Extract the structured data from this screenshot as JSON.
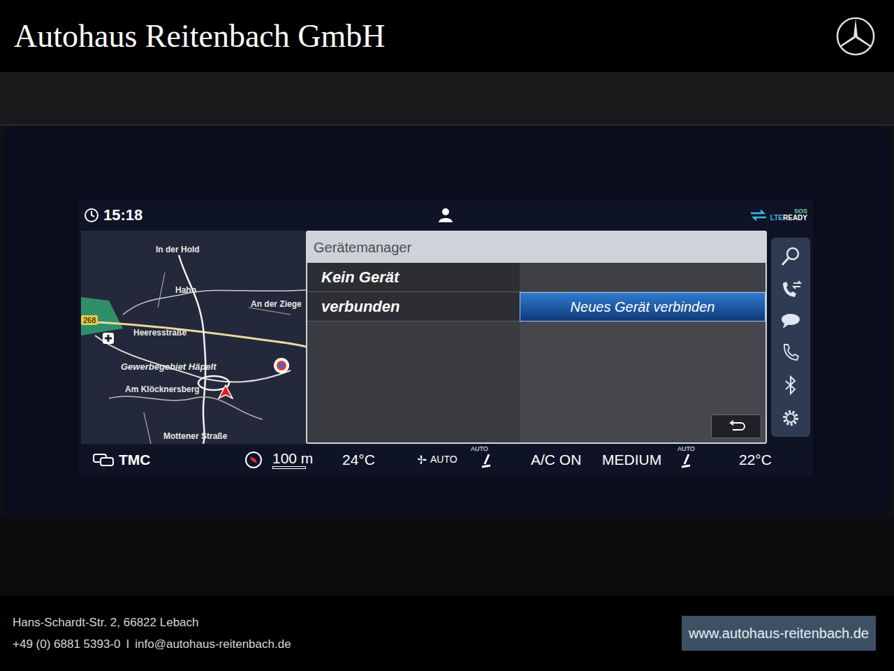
{
  "header": {
    "title": "Autohaus Reitenbach GmbH"
  },
  "status_bar": {
    "time": "15:18",
    "connectivity_top": "SOS",
    "connectivity_left": "LTE",
    "connectivity_right": "READY"
  },
  "map": {
    "road_badge": "268",
    "labels": [
      {
        "text": "In der Hold"
      },
      {
        "text": "Hahn"
      },
      {
        "text": "An der Ziege"
      },
      {
        "text": "Heeresstraße"
      },
      {
        "text": "Gewerbegebiet Häpelt"
      },
      {
        "text": "Am Klöcknersberg"
      },
      {
        "text": "Mottener Straße"
      }
    ]
  },
  "dialog": {
    "title": "Gerätemanager",
    "status_lines": [
      "Kein Gerät",
      "verbunden"
    ],
    "actions": [
      {
        "label": "Neues Gerät verbinden",
        "selected": true
      }
    ]
  },
  "climate_bar": {
    "traffic": "TMC",
    "scale": "100 m",
    "temp_left": "24°C",
    "fan": "AUTO",
    "seat_left": "AUTO",
    "ac": "A/C ON",
    "intensity": "MEDIUM",
    "seat_right": "AUTO",
    "temp_right": "22°C"
  },
  "footer": {
    "address": "Hans-Schardt-Str. 2, 66822 Lebach",
    "phone": "+49 (0) 6881 5393-0",
    "separator": "I",
    "email": "info@autohaus-reitenbach.de",
    "website": "www.autohaus-reitenbach.de"
  }
}
